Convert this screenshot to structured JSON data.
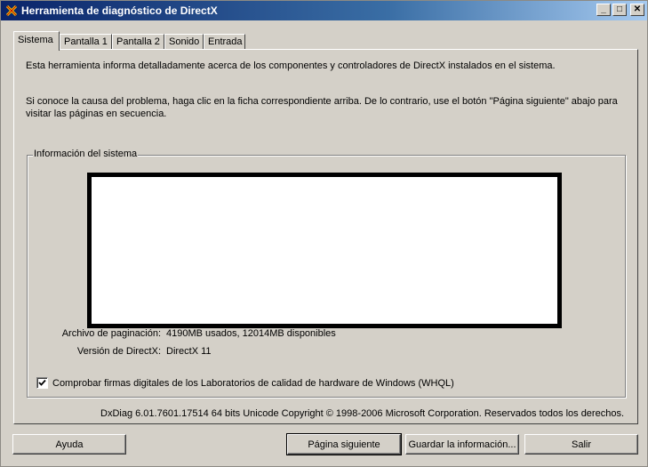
{
  "window": {
    "title": "Herramienta de diagnóstico de DirectX",
    "buttons": {
      "minimize": "_",
      "maximize": "□",
      "close": "✕"
    }
  },
  "tabs": [
    {
      "label": "Sistema"
    },
    {
      "label": "Pantalla 1"
    },
    {
      "label": "Pantalla 2"
    },
    {
      "label": "Sonido"
    },
    {
      "label": "Entrada"
    }
  ],
  "intro": {
    "paragraph1": "Esta herramienta informa detalladamente acerca de los componentes y controladores de DirectX instalados en el sistema.",
    "paragraph2": "Si conoce la causa del problema, haga clic en la ficha correspondiente arriba. De lo contrario, use el botón \"Página siguiente\" abajo para visitar las páginas en secuencia."
  },
  "system_info": {
    "group_label": "Información del sistema",
    "paging_label": "Archivo de paginación:",
    "paging_value": "4190MB usados, 12014MB disponibles",
    "directx_label": "Versión de DirectX:",
    "directx_value": "DirectX 11",
    "whql_checkbox_label": "Comprobar firmas digitales de los Laboratorios de calidad de hardware de Windows (WHQL)",
    "whql_checked": true
  },
  "footer": {
    "text": "DxDiag 6.01.7601.17514 64 bits  Unicode  Copyright © 1998-2006 Microsoft Corporation. Reservados todos los derechos."
  },
  "buttons": {
    "help": "Ayuda",
    "next_page": "Página siguiente",
    "save_info": "Guardar la información...",
    "exit": "Salir"
  }
}
